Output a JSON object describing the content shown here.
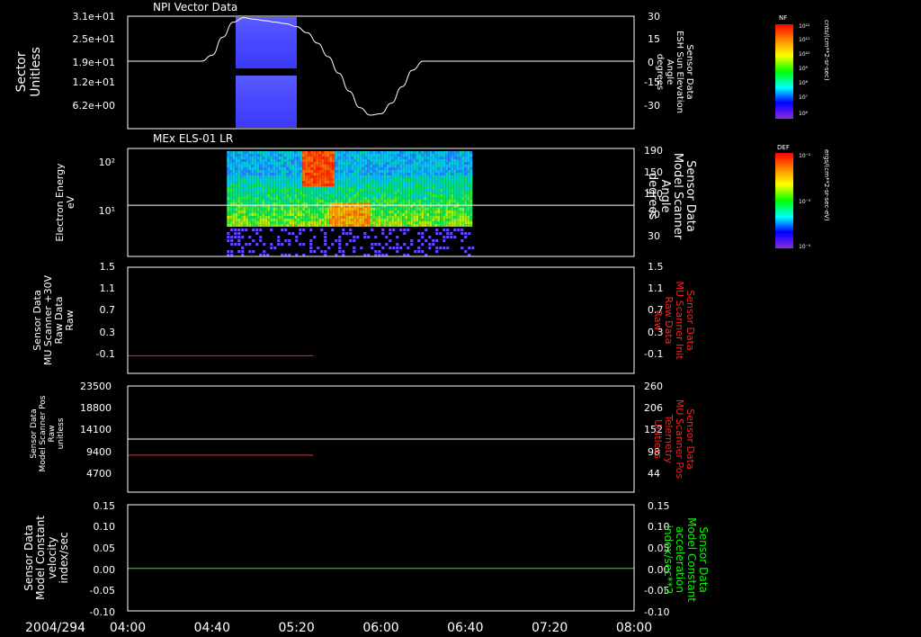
{
  "figure": {
    "date_label": "2004/294",
    "time_ticks": [
      "04:00",
      "04:40",
      "05:20",
      "06:00",
      "06:40",
      "07:20",
      "08:00"
    ],
    "time_tick_minutes": [
      0,
      40,
      80,
      120,
      160,
      200,
      240
    ],
    "start_time": "04:00",
    "end_time": "08:00"
  },
  "colors": {
    "background": "#000000",
    "axes": "#ffffff",
    "red_trace": "#ff2020",
    "green_trace": "#00ff00",
    "red_label": "#ff2020",
    "green_label": "#00ff00"
  },
  "panels": [
    {
      "id": "p1",
      "title": "NPI Vector Data",
      "left_label": [
        "Sector",
        "Unitless"
      ],
      "left_ticks": [
        "3.1e+01",
        "2.5e+01",
        "1.9e+01",
        "1.2e+01",
        "6.2e+00"
      ],
      "right_label": [
        "Sensor Data",
        "ESH Sun Elevation",
        "Angle",
        "degrees"
      ],
      "right_ticks": [
        "30",
        "15",
        "0",
        "-15",
        "-30"
      ],
      "colorbar": {
        "name": "NF",
        "unit": "cnts/(cm**2-sr-sec)",
        "ticks": [
          "10¹²",
          "10¹¹",
          "10¹⁰",
          "10⁹",
          "10⁸",
          "10⁷",
          "10⁶"
        ]
      }
    },
    {
      "id": "p2",
      "title": "MEx ELS-01 LR",
      "left_label": [
        "Electron Energy",
        "eV"
      ],
      "left_ticks": [
        "10²",
        "10¹"
      ],
      "right_label": [
        "Sensor Data",
        "Model Scanner",
        "Angle",
        "degrees"
      ],
      "right_ticks": [
        "190",
        "150",
        "110",
        "70",
        "30"
      ],
      "colorbar": {
        "name": "DEF",
        "unit": "ergs/(cm**2-sr-sec-eV)",
        "ticks": [
          "10⁻²",
          "10⁻³",
          "10⁻⁴"
        ]
      }
    },
    {
      "id": "p3",
      "left_label": [
        "Sensor Data",
        "MU Scanner +30V",
        "Raw Data",
        "Raw"
      ],
      "left_ticks": [
        "1.5",
        "1.1",
        "0.7",
        "0.3",
        "-0.1"
      ],
      "right_label": [
        "Sensor Data",
        "MU Scanner Init",
        "Raw Data",
        "Raw"
      ],
      "right_ticks": [
        "1.5",
        "1.1",
        "0.7",
        "0.3",
        "-0.1"
      ]
    },
    {
      "id": "p4",
      "left_label": [
        "Sensor Data",
        "Model Scanner Pos",
        "Raw",
        "unitless"
      ],
      "left_ticks": [
        "23500",
        "18800",
        "14100",
        "9400",
        "4700"
      ],
      "right_label": [
        "Sensor Data",
        "MU Scanner Pos",
        "Telemetry",
        "Unitless"
      ],
      "right_ticks": [
        "260",
        "206",
        "152",
        "98",
        "44"
      ]
    },
    {
      "id": "p5",
      "left_label": [
        "Sensor Data",
        "Model Constant",
        "velocity",
        "index/sec"
      ],
      "left_ticks": [
        "0.15",
        "0.10",
        "0.05",
        "0.00",
        "-0.05",
        "-0.10"
      ],
      "right_label": [
        "Sensor Data",
        "Model Constant",
        "acceleration",
        "index/sec**2"
      ],
      "right_ticks": [
        "0.15",
        "0.10",
        "0.05",
        "0.00",
        "-0.05",
        "-0.10"
      ]
    }
  ],
  "chart_data": [
    {
      "type": "heatmap",
      "title": "NPI Vector Data",
      "ylabel": "Sector Unitless",
      "y2label": "Sensor Data ESH Sun Elevation Angle degrees",
      "ylim": [
        1,
        31
      ],
      "y2lim": [
        -45,
        30
      ],
      "heatmap_time_range_min": [
        47,
        87
      ],
      "gaps_sector": [
        [
          18.8,
          20.2
        ]
      ],
      "overlay_series": {
        "name": "Sensor Data ESH Sun Elevation Angle",
        "axis": "right",
        "x_minutes": [
          0,
          30,
          35,
          40,
          45,
          50,
          55,
          60,
          65,
          70,
          75,
          80,
          85,
          90,
          95,
          100,
          105,
          110,
          115,
          120,
          125,
          130,
          135,
          140,
          145,
          240
        ],
        "y": [
          0,
          0,
          0,
          4,
          16,
          26,
          29,
          28,
          27,
          26,
          25,
          23,
          19,
          12,
          3,
          -8,
          -20,
          -31,
          -36,
          -35,
          -28,
          -17,
          -6,
          0,
          0,
          0
        ]
      }
    },
    {
      "type": "heatmap",
      "title": "MEx ELS-01 LR",
      "ylabel": "Electron Energy eV",
      "y2label": "Sensor Data Model Scanner Angle degrees",
      "yscale": "log",
      "ylim": [
        1,
        200
      ],
      "y2lim": [
        0,
        190
      ],
      "heatmap_time_range_min": [
        47,
        163
      ],
      "overlay_series": {
        "name": "Sensor Data Model Scanner Angle",
        "axis": "right",
        "x_minutes": [
          0,
          240
        ],
        "y": [
          90,
          90
        ]
      }
    },
    {
      "type": "line",
      "ylabel": "Sensor Data MU Scanner +30V Raw Data Raw",
      "y2label": "Sensor Data MU Scanner Init Raw Data Raw",
      "ylim": [
        -0.3,
        1.5
      ],
      "series": [
        {
          "x_minutes": [
            0,
            88
          ],
          "y": [
            0,
            0
          ],
          "color": "red_trace"
        }
      ]
    },
    {
      "type": "line",
      "ylabel": "Sensor Data Model Scanner Pos Raw unitless",
      "y2label": "Sensor Data MU Scanner Pos Telemetry Unitless",
      "ylim": [
        0,
        23500
      ],
      "y2lim": [
        0,
        260
      ],
      "series": [
        {
          "axis": "left",
          "x_minutes": [
            0,
            240
          ],
          "y": [
            11750,
            11750
          ],
          "color": "axes"
        },
        {
          "axis": "left",
          "x_minutes": [
            0,
            88
          ],
          "y": [
            8200,
            8200
          ],
          "color": "red_trace"
        }
      ]
    },
    {
      "type": "line",
      "ylabel": "Sensor Data Model Constant velocity index/sec",
      "y2label": "Sensor Data Model Constant acceleration index/sec**2",
      "ylim": [
        -0.1,
        0.15
      ],
      "series": [
        {
          "x_minutes": [
            0,
            240
          ],
          "y": [
            0,
            0
          ],
          "color": "green_trace"
        }
      ]
    }
  ]
}
